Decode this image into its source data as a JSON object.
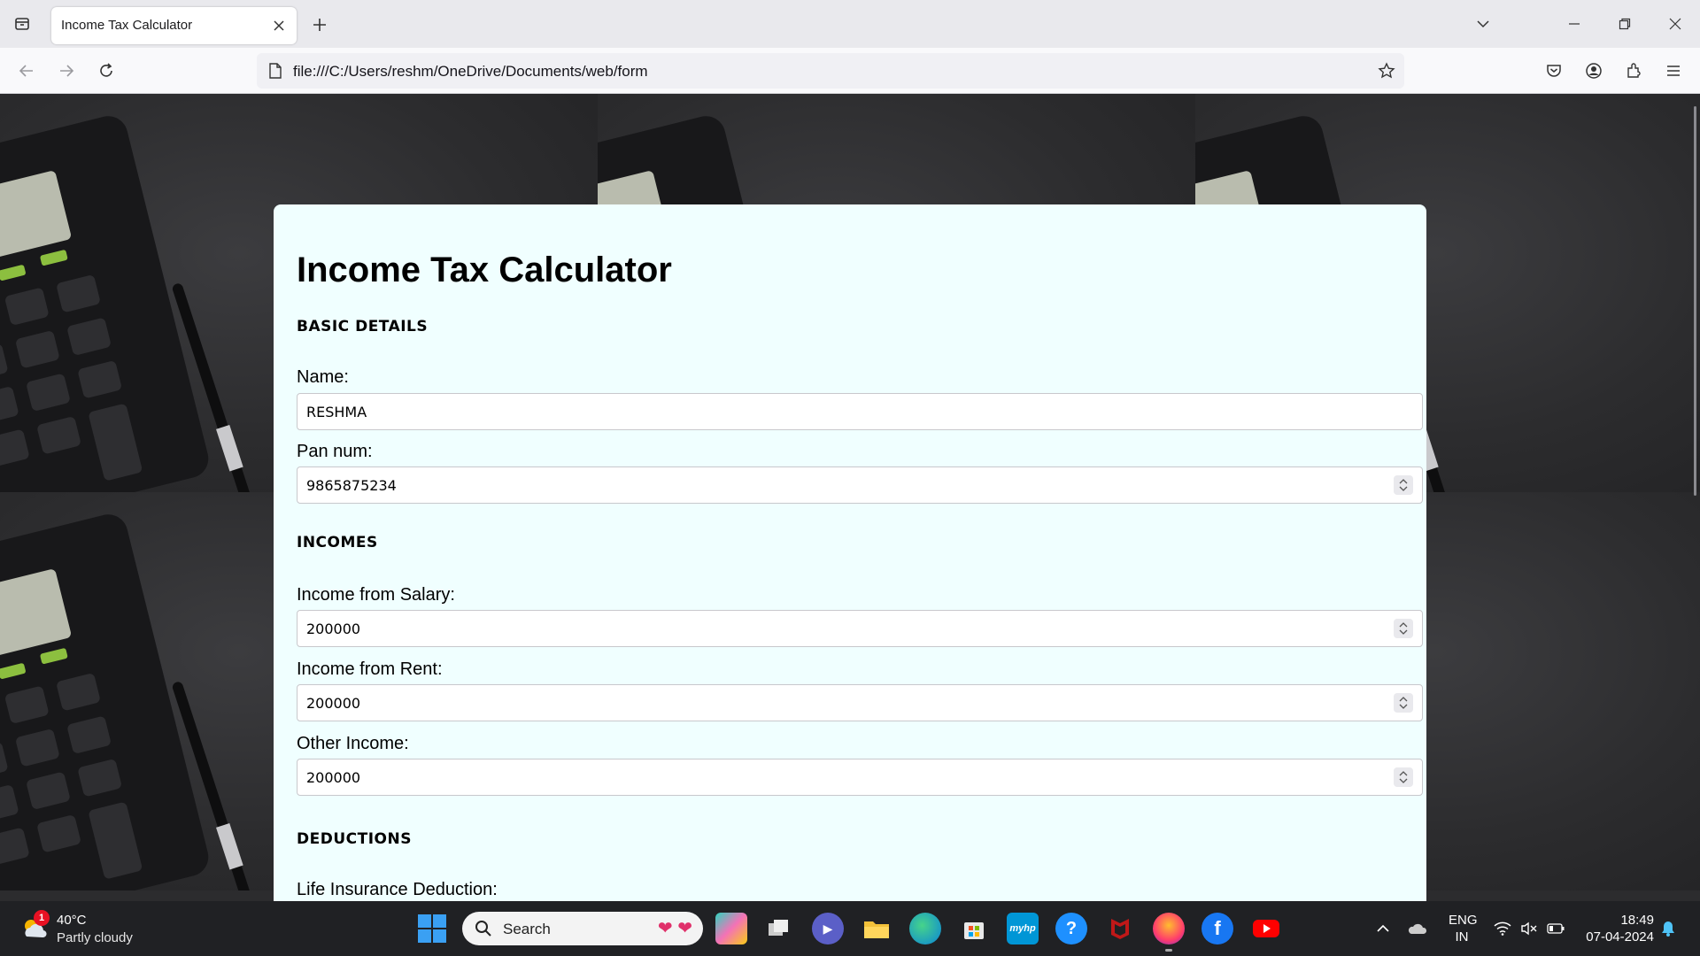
{
  "browser": {
    "tab_title": "Income Tax Calculator",
    "url": "file:///C:/Users/reshm/OneDrive/Documents/web/form"
  },
  "page": {
    "title": "Income Tax Calculator",
    "sections": {
      "basic": "BASIC DETAILS",
      "incomes": "INCOMES",
      "deductions": "DEDUCTIONS"
    },
    "fields": {
      "name": {
        "label": "Name:",
        "value": "RESHMA"
      },
      "pan": {
        "label": "Pan num:",
        "value": "9865875234"
      },
      "salary": {
        "label": "Income from Salary:",
        "value": "200000"
      },
      "rent": {
        "label": "Income from Rent:",
        "value": "200000"
      },
      "other": {
        "label": "Other Income:",
        "value": "200000"
      },
      "life_insurance": {
        "label": "Life Insurance Deduction:"
      }
    }
  },
  "taskbar": {
    "weather": {
      "temp": "40°C",
      "desc": "Partly cloudy",
      "badge": "1"
    },
    "search_placeholder": "Search",
    "language": {
      "line1": "ENG",
      "line2": "IN"
    },
    "time": "18:49",
    "date": "07-04-2024",
    "apps": [
      "copilot-icon",
      "task-view-icon",
      "teams-icon",
      "file-explorer-icon",
      "edge-icon",
      "ms-store-icon",
      "myhp-icon",
      "help-icon",
      "mcafee-icon",
      "firefox-icon",
      "facebook-icon",
      "youtube-icon"
    ]
  }
}
